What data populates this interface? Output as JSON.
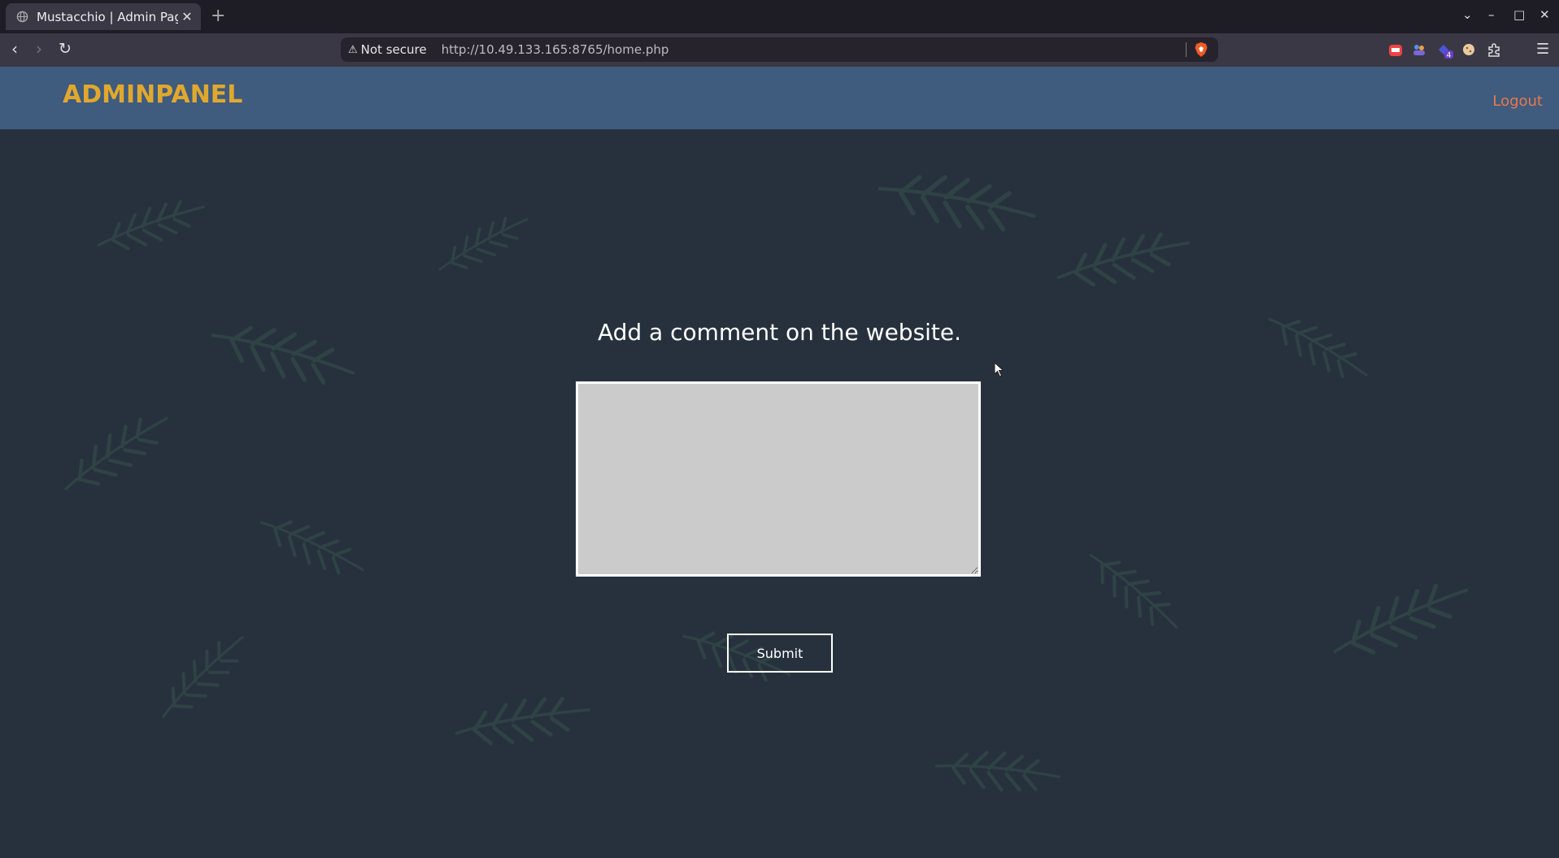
{
  "browser": {
    "tab": {
      "title": "Mustacchio | Admin Pag",
      "close_glyph": "✕"
    },
    "new_tab_glyph": "+",
    "window_controls": {
      "tab_list": "⌄",
      "minimize": "–",
      "maximize": "□",
      "close": "✕"
    },
    "nav": {
      "back": "‹",
      "forward": "›",
      "reload": "↻"
    },
    "address": {
      "security_icon": "⚠",
      "security_label": "Not secure",
      "url": "http://10.49.133.165:8765/home.php"
    },
    "menu_glyph": "☰"
  },
  "page": {
    "brand": "ADMINPANEL",
    "logout": "Logout",
    "heading": "Add a comment on the website.",
    "comment": {
      "value": "",
      "placeholder": ""
    },
    "submit_label": "Submit"
  },
  "colors": {
    "navbar": "#3f5b7e",
    "brand": "#e0a82e",
    "logout": "#e8794d",
    "page_bg": "#27313e",
    "textarea": "#cbcbcb"
  }
}
